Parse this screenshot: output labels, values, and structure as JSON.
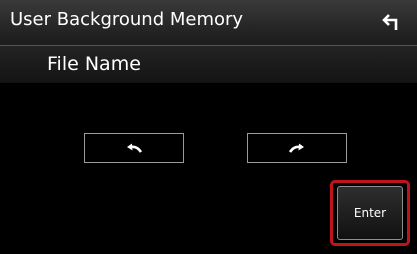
{
  "header": {
    "title": "User Background Memory",
    "back_icon": "return-arrow-icon"
  },
  "file": {
    "label": "File Name"
  },
  "navigation": {
    "prev_icon": "curved-arrow-left-icon",
    "next_icon": "curved-arrow-right-icon"
  },
  "actions": {
    "enter_label": "Enter"
  },
  "colors": {
    "background": "#000000",
    "highlight": "#c0141b",
    "text": "#ffffff"
  }
}
